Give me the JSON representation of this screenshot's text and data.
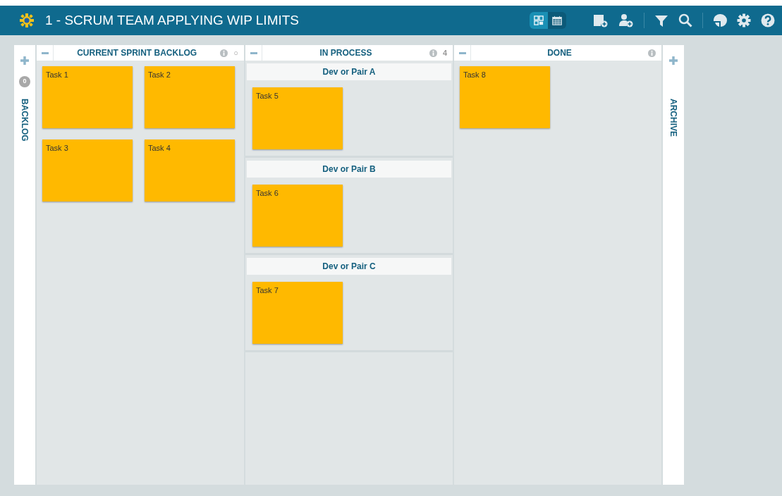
{
  "window": {
    "title": "1 - SCRUM TEAM APPLYING WIP LIMITS"
  },
  "view_toggle": [
    {
      "selected": true
    },
    {
      "selected": false
    }
  ],
  "backlog": {
    "label": "BACKLOG",
    "count": "0"
  },
  "columns": [
    {
      "title": "CURRENT SPRINT BACKLOG",
      "limit": "○",
      "kind": "cards",
      "cards": [
        {
          "title": "Task 1"
        },
        {
          "title": "Task 2"
        },
        {
          "title": "Task 3"
        },
        {
          "title": "Task 4"
        }
      ]
    },
    {
      "title": "IN PROCESS",
      "limit": "4",
      "kind": "lanes",
      "lanes": [
        {
          "title": "Dev or Pair A",
          "cards": [
            {
              "title": "Task 5"
            }
          ]
        },
        {
          "title": "Dev or Pair B",
          "cards": [
            {
              "title": "Task 6"
            }
          ]
        },
        {
          "title": "Dev or Pair C",
          "cards": [
            {
              "title": "Task 7"
            }
          ]
        }
      ]
    },
    {
      "title": "DONE",
      "kind": "cards",
      "cards": [
        {
          "title": "Task 8"
        }
      ]
    }
  ],
  "archive": {
    "label": "ARCHIVE"
  }
}
